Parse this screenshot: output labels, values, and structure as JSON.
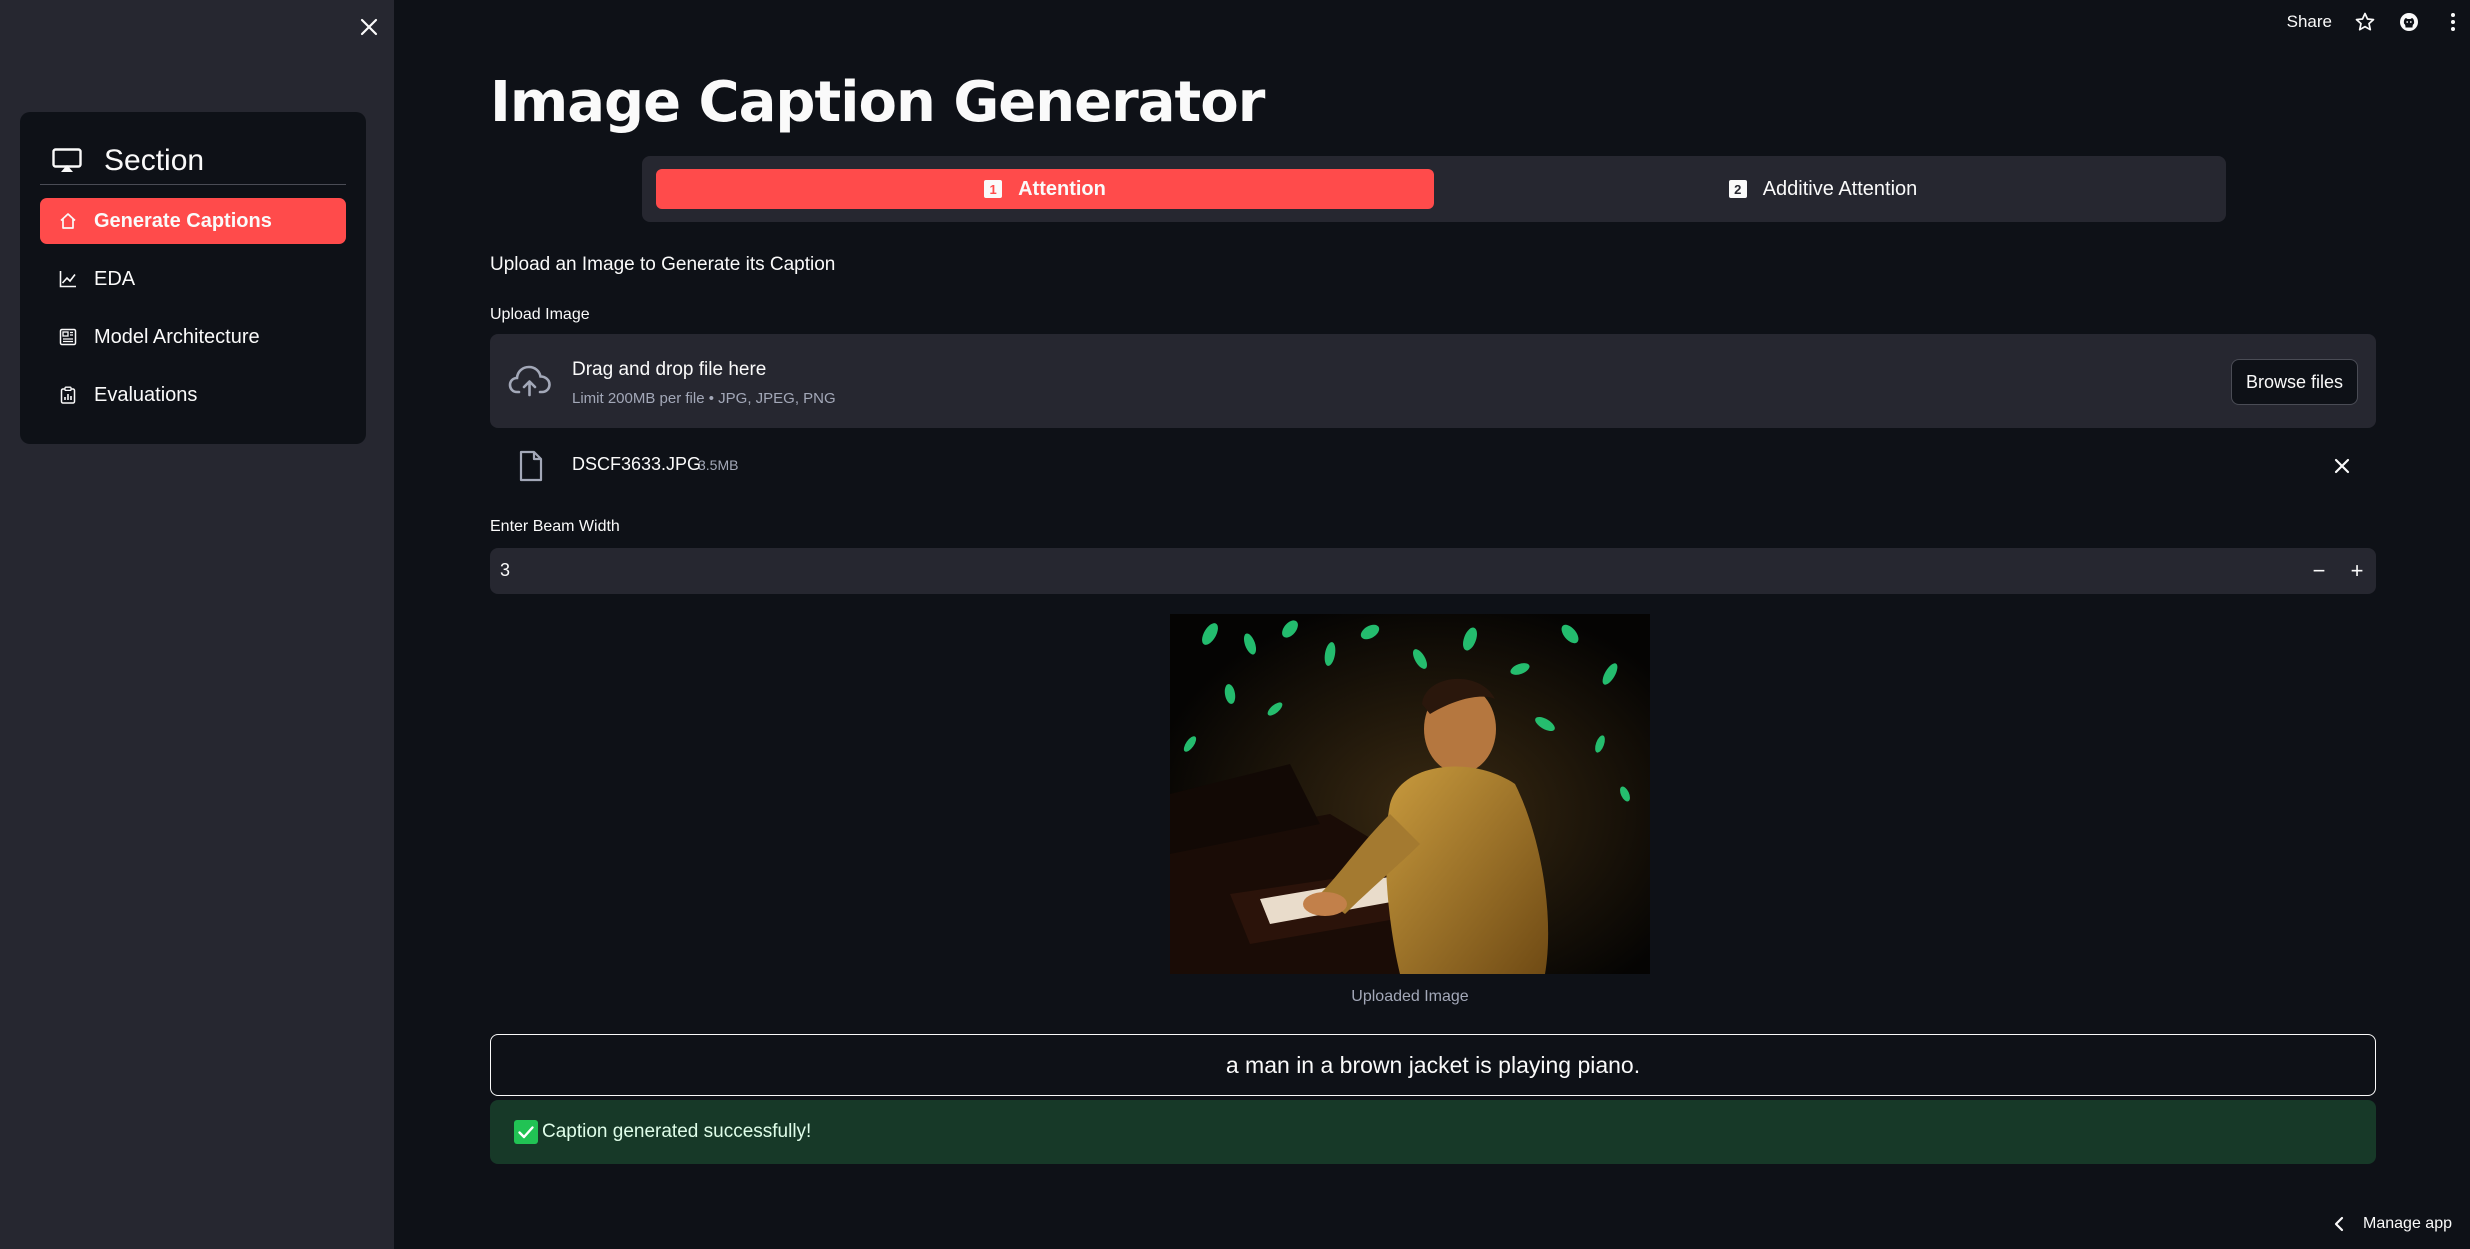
{
  "sidebar": {
    "menu_title": "Section",
    "items": [
      {
        "label": "Generate Captions",
        "icon": "house-icon",
        "active": true
      },
      {
        "label": "EDA",
        "icon": "graph-up-icon",
        "active": false
      },
      {
        "label": "Model Architecture",
        "icon": "motherboard-icon",
        "active": false
      },
      {
        "label": "Evaluations",
        "icon": "clipboard-data-icon",
        "active": false
      }
    ]
  },
  "header": {
    "share_label": "Share"
  },
  "main": {
    "title": "Image Caption Generator",
    "tabs": [
      {
        "num": "1",
        "label": "Attention",
        "active": true
      },
      {
        "num": "2",
        "label": "Additive Attention",
        "active": false
      }
    ],
    "subheading": "Upload an Image to Generate its Caption",
    "upload": {
      "label": "Upload Image",
      "dropzone_title": "Drag and drop file here",
      "dropzone_hint": "Limit 200MB per file • JPG, JPEG, PNG",
      "browse_label": "Browse files",
      "file_name": "DSCF3633.JPG",
      "file_size": "3.5MB"
    },
    "beam": {
      "label": "Enter Beam Width",
      "value": "3",
      "minus": "−",
      "plus": "+"
    },
    "image_caption": "Uploaded Image",
    "generated_caption": "a man in a brown jacket is playing piano.",
    "success_message": "Caption generated successfully!"
  },
  "footer": {
    "manage_label": "Manage app"
  },
  "colors": {
    "background": "#0e1117",
    "sidebar": "#262730",
    "accent": "#ff4b4b",
    "success_bg": "#173928",
    "success_check": "#21c354"
  }
}
